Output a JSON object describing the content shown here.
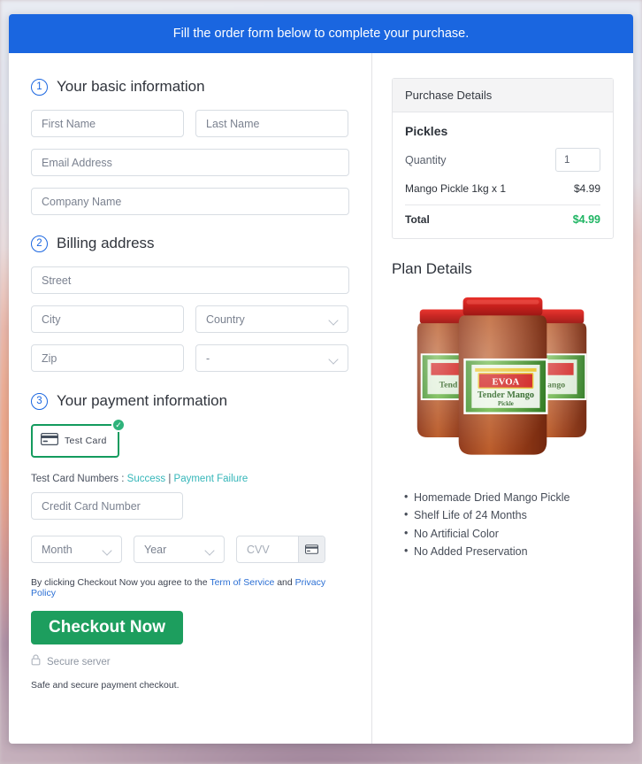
{
  "banner": {
    "text": "Fill the order form below to complete your purchase."
  },
  "sections": {
    "basic": {
      "number": "1",
      "title": "Your basic information",
      "fields": {
        "first_name": "First Name",
        "last_name": "Last Name",
        "email": "Email Address",
        "company": "Company Name"
      }
    },
    "billing": {
      "number": "2",
      "title": "Billing address",
      "fields": {
        "street": "Street",
        "city": "City",
        "country": "Country",
        "zip": "Zip",
        "state": "-"
      }
    },
    "payment": {
      "number": "3",
      "title": "Your payment information",
      "method_tile": {
        "label": "Test Card",
        "icon": "credit-card-icon",
        "selected_badge": "✓"
      },
      "test_numbers": {
        "prefix": "Test Card Numbers :",
        "success_link": "Success",
        "separator": "|",
        "failure_link": "Payment Failure"
      },
      "card_number": "Credit Card Number",
      "month": "Month",
      "year": "Year",
      "cvv": "CVV",
      "cvv_icon": "credit-card-icon",
      "terms": {
        "pre": "By clicking Checkout Now you agree to the",
        "link1": "Term of Service",
        "mid": "and",
        "link2": "Privacy Policy"
      },
      "checkout_label": "Checkout Now",
      "secure_icon": "lock-icon",
      "secure_label": "Secure server",
      "safe_note": "Safe and secure payment checkout."
    }
  },
  "purchase_details": {
    "heading": "Purchase Details",
    "product_name": "Pickles",
    "quantity_label": "Quantity",
    "quantity_value": "1",
    "line_item": {
      "description": "Mango Pickle 1kg x 1",
      "amount": "$4.99"
    },
    "total": {
      "label": "Total",
      "amount": "$4.99"
    }
  },
  "plan_details": {
    "heading": "Plan Details",
    "image_alt": "three-mango-pickle-jars",
    "product_brand": "EVOA",
    "product_label_line1": "Tender Mango",
    "product_label_line2": "Pickle",
    "features": [
      "Homemade Dried Mango Pickle",
      "Shelf Life of 24 Months",
      "No Artificial Color",
      "No Added Preservation"
    ]
  },
  "colors": {
    "banner_blue": "#1a66e0",
    "accent_blue": "#2b6fd4",
    "success_green": "#1d9e5e",
    "total_green": "#1fb563",
    "link_teal": "#35b6b9",
    "tile_border_green": "#149b5e"
  }
}
